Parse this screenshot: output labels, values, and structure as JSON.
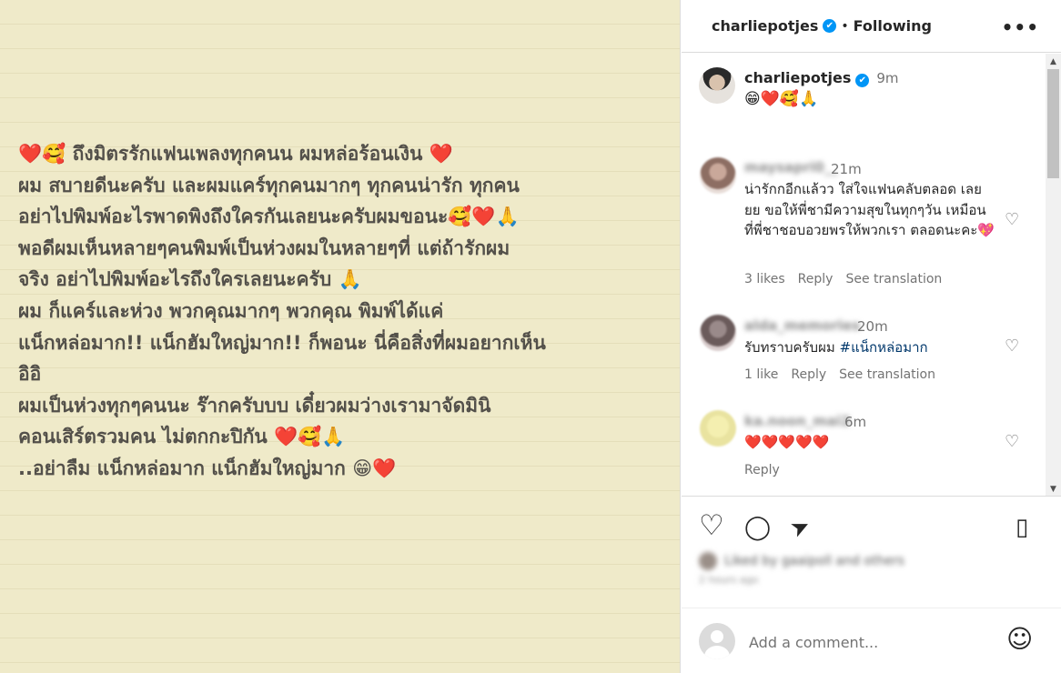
{
  "post_image": {
    "lines": [
      "❤️🥰 ถึงมิตรรักแฟนเพลงทุกคนน ผมหล่อร้อนเงิน ❤️",
      "ผม สบายดีนะครับ และผมแคร์ทุกคนมากๆ ทุกคนน่ารัก ทุกคน",
      "อย่าไปพิมพ์อะไรพาดพิงถึงใครกันเลยนะครับผมขอนะ🥰❤️🙏",
      " พอดีผมเห็นหลายๆคนพิมพ์เป็นห่วงผมในหลายๆที่ แต่ถ้ารักผม",
      "จริง อย่าไปพิมพ์อะไรถึงใครเลยนะครับ 🙏",
      " ผม ก็แคร์และห่วง พวกคุณมากๆ พวกคุณ พิมพ์ได้แค่",
      "แน็กหล่อมาก!!  แน็กฮัมใหญ่มาก!! ก็พอนะ นี่คือสิ่งที่ผมอยากเห็น",
      "อิอิ",
      "ผมเป็นห่วงทุกๆคนนะ ร๊ากครับบบ เดี๋ยวผมว่างเรามาจัดมินิ",
      "คอนเสิร์ตรวมคน ไม่ตกกะปิกัน ❤️🥰🙏",
      "..อย่าลืม แน็กหล่อมาก แน็กฮัมใหญ่มาก 😁❤️"
    ]
  },
  "header": {
    "username": "charliepotjes",
    "verified_icon": "✔",
    "separator": "•",
    "follow_status": "Following",
    "more_icon": "•••"
  },
  "caption": {
    "username": "charliepotjes",
    "time": "9m",
    "text": "😁❤️🥰🙏"
  },
  "comments": [
    {
      "username": "maysapri0__",
      "time": "21m",
      "text": "น่ารักกอีกแล้วว ใส่ใจแฟนคลับตลอด เลยยย ขอให้พี่ชามีความสุขในทุกๆวัน เหมือนที่พี่ชาชอบอวยพรให้พวกเรา ตลอดนะคะ💖",
      "likes": "3 likes",
      "reply": "Reply",
      "translate": "See translation"
    },
    {
      "username": "alda_memories",
      "time": "20m",
      "text_prefix": "รับทราบครับผม ",
      "hashtag": "#แน็กหล่อมาก",
      "likes": "1 like",
      "reply": "Reply",
      "translate": "See translation"
    },
    {
      "username": "ka.noon_mai2",
      "time": "6m",
      "text": "❤️❤️❤️❤️❤️",
      "reply": "Reply"
    }
  ],
  "actions": {
    "like_icon": "♡",
    "comment_icon": "◯",
    "share_icon": "➤",
    "save_icon": "▯"
  },
  "likes_summary": "Liked by gaaipoll and others",
  "post_date": "2 hours ago",
  "add_comment": {
    "placeholder": "Add a comment...",
    "emoji_icon": "☺"
  },
  "scrollbar": {
    "up": "▲",
    "down": "▼"
  }
}
